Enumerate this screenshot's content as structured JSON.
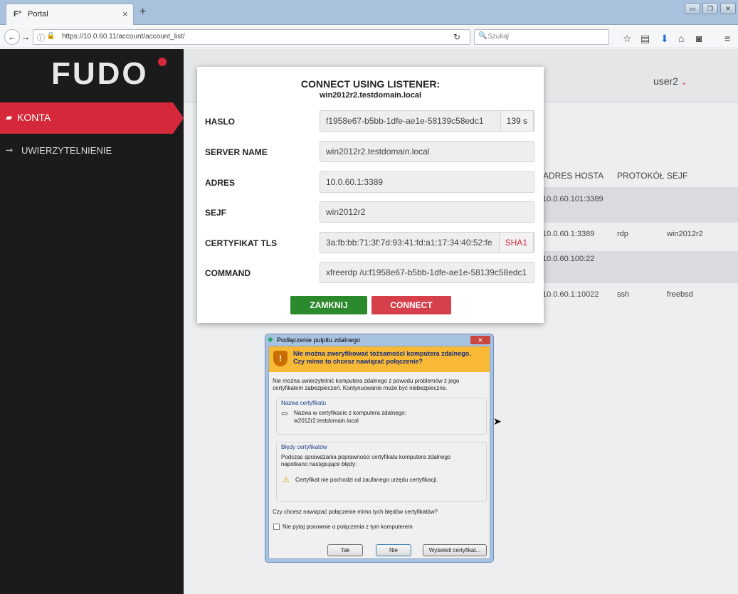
{
  "browser": {
    "tab_title": "Portal",
    "tab_favicon": "F°",
    "tab_close": "×",
    "new_tab": "+",
    "url": "https://10.0.60.11/account/account_list/",
    "search_placeholder": "Szukaj",
    "window_minimize": "▭",
    "window_restore": "❐",
    "window_close": "✕"
  },
  "sidebar": {
    "logo": "FUDO",
    "items": [
      {
        "label": "KONTA",
        "active": true
      },
      {
        "label": "UWIERZYTELNIENIE",
        "active": false
      }
    ]
  },
  "header": {
    "user": "user2"
  },
  "table": {
    "headers": [
      "ADRES HOSTA",
      "PROTOKÓŁ",
      "SEJF"
    ],
    "rows": [
      {
        "host": "10.0.60.101:3389",
        "protocol": "",
        "safe": ""
      },
      {
        "host": "10.0.60.1:3389",
        "protocol": "rdp",
        "safe": "win2012r2"
      },
      {
        "host": "10.0.60.100:22",
        "protocol": "",
        "safe": ""
      },
      {
        "host": "10.0.60.1:10022",
        "protocol": "ssh",
        "safe": "freebsd"
      }
    ]
  },
  "modal": {
    "title": "CONNECT USING LISTENER:",
    "subtitle": "win2012r2.testdomain.local",
    "fields": [
      {
        "label": "HASLO",
        "value": "f1958e67-b5bb-1dfe-ae1e-58139c58edc1",
        "addon": "139 s"
      },
      {
        "label": "SERVER NAME",
        "value": "win2012r2.testdomain.local",
        "addon": ""
      },
      {
        "label": "ADRES",
        "value": "10.0.60.1:3389",
        "addon": ""
      },
      {
        "label": "SEJF",
        "value": "win2012r2",
        "addon": ""
      },
      {
        "label": "CERTYFIKAT TLS",
        "value": "3a:fb:bb:71:3f:7d:93:41:fd:a1:17:34:40:52:fe",
        "addon": "SHA1"
      },
      {
        "label": "COMMAND",
        "value": "xfreerdp /u:f1958e67-b5bb-1dfe-ae1e-58139c58edc1",
        "addon": ""
      }
    ],
    "close_label": "ZAMKNIJ",
    "connect_label": "CONNECT"
  },
  "rdp_dialog": {
    "title": "Podłączenie pulpitu zdalnego",
    "warning_line1": "Nie można zweryfikować tożsamości komputera zdalnego.",
    "warning_line2": "Czy mimo to chcesz nawiązać połączenie?",
    "intro_line1": "Nie można uwierzytelnić komputera zdalnego z powodu problemów z jego",
    "intro_line2": "certyfikatem zabezpieczeń. Kontynuowanie może być niebezpieczne.",
    "cert_name_group": "Nazwa certyfikatu",
    "cert_name_line1": "Nazwa w certyfikacie z komputera zdalnego:",
    "cert_name_line2": "w2012r2.testdomain.local",
    "errors_group": "Błędy certyfikatów",
    "errors_line1": "Podczas sprawdzania poprawności certyfikatu komputera zdalnego",
    "errors_line2": "napotkano następujące błędy:",
    "error_item": "Certyfikat nie pochodzi od zaufanego urzędu certyfikacji.",
    "question": "Czy chcesz nawiązać połączenie mimo tych błędów certyfikatów?",
    "checkbox_label": "Nie pytaj ponownie o połączenia z tym komputerem",
    "btn_yes": "Tak",
    "btn_no": "Nie",
    "btn_view_cert": "Wyświetl certyfikat..."
  },
  "colors": {
    "accent": "#d6283b",
    "green": "#2a8a2c",
    "sidebar": "#1b1b1b"
  }
}
